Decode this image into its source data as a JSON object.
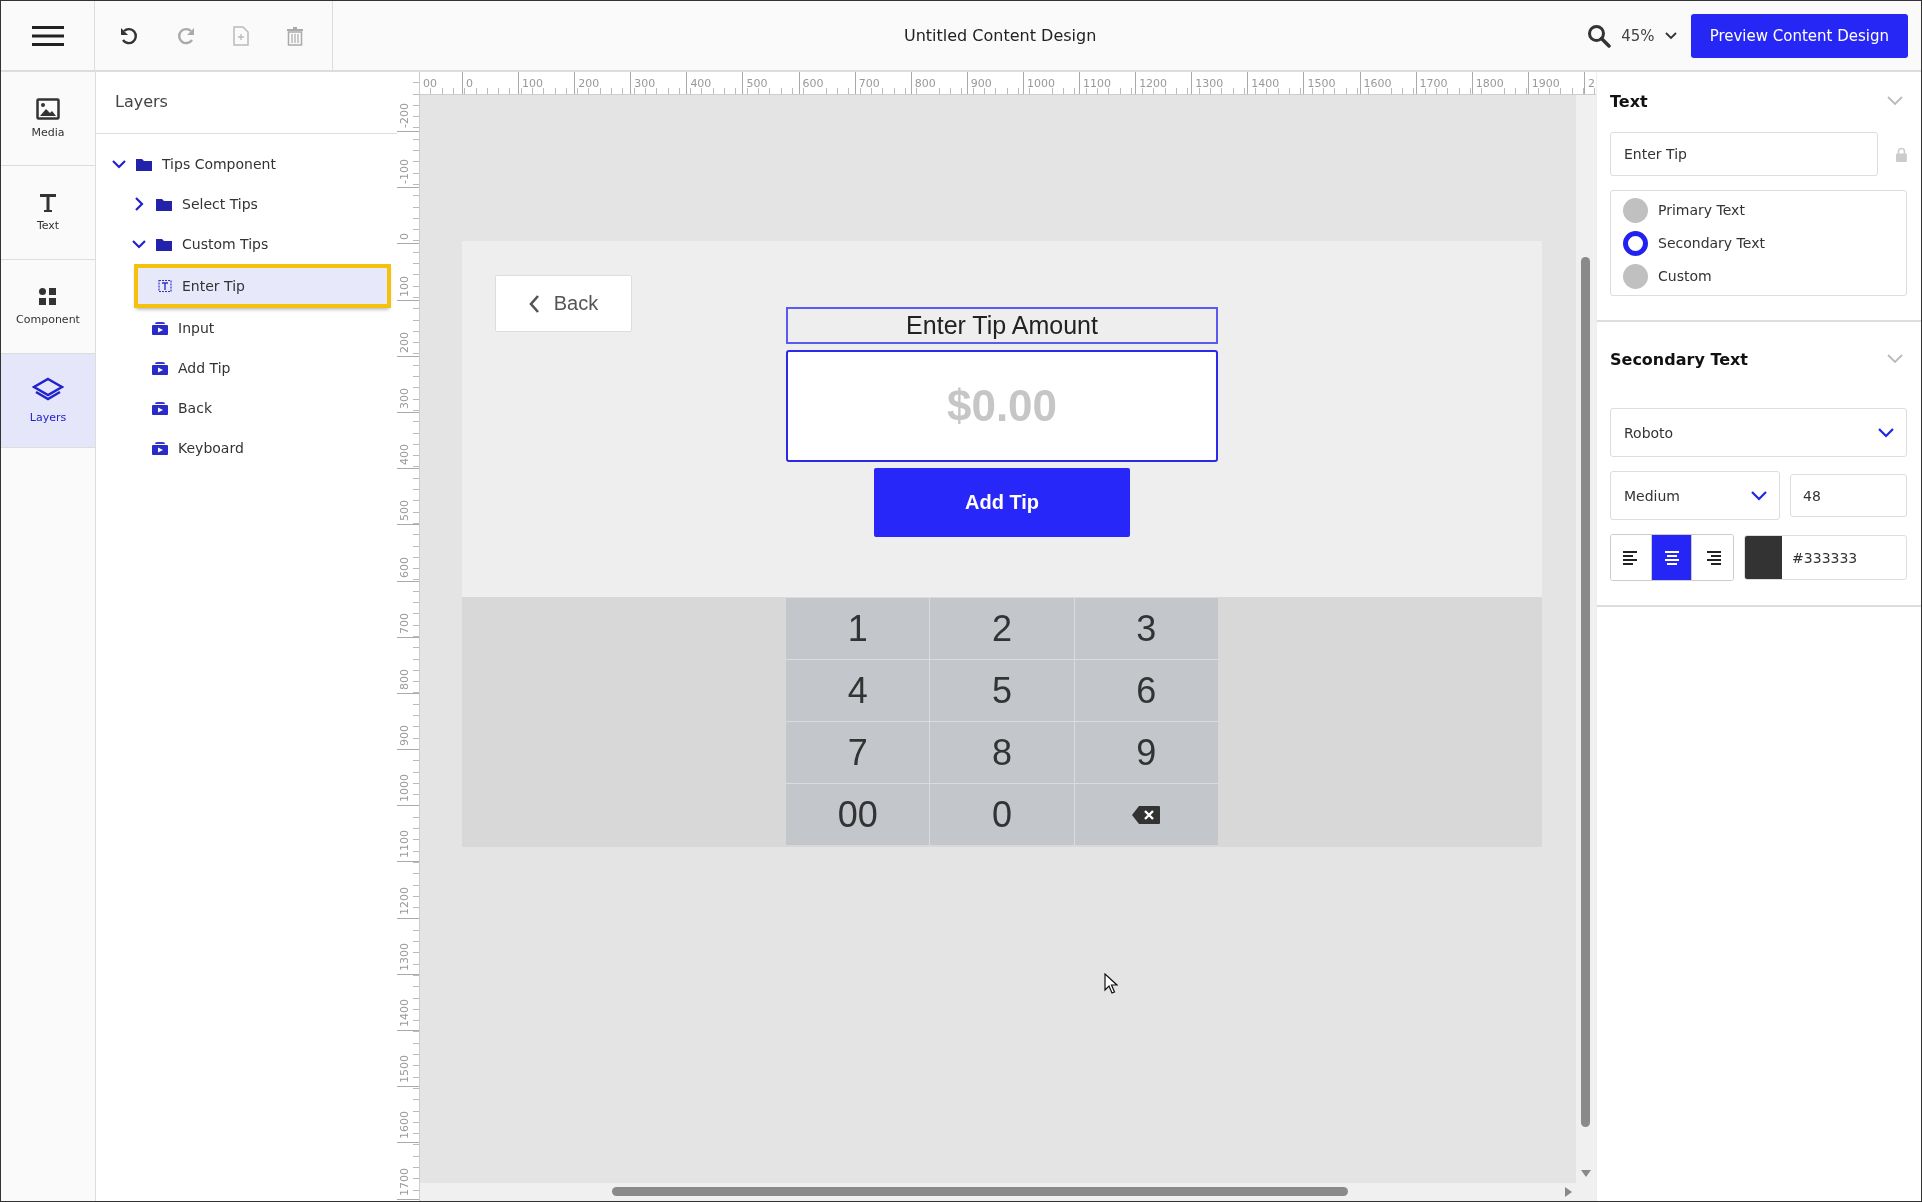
{
  "toolbar": {
    "title": "Untitled Content Design",
    "zoom": "45%",
    "preview_button": "Preview Content Design"
  },
  "rail": [
    {
      "label": "Media",
      "kind": "media",
      "selected": false
    },
    {
      "label": "Text",
      "kind": "text",
      "selected": false
    },
    {
      "label": "Component",
      "kind": "component",
      "selected": false
    },
    {
      "label": "Layers",
      "kind": "layers",
      "selected": true
    }
  ],
  "layers": {
    "title": "Layers",
    "tree": [
      {
        "label": "Tips Component",
        "kind": "folder",
        "expanded": true,
        "selected": false,
        "children": [
          {
            "label": "Select Tips",
            "kind": "folder",
            "expanded": false,
            "selected": false
          },
          {
            "label": "Custom Tips",
            "kind": "folder",
            "expanded": true,
            "selected": false,
            "children": [
              {
                "label": "Enter Tip",
                "kind": "text",
                "selected": true
              },
              {
                "label": "Input",
                "kind": "component",
                "selected": false
              },
              {
                "label": "Add Tip",
                "kind": "component",
                "selected": false
              },
              {
                "label": "Back",
                "kind": "component",
                "selected": false
              },
              {
                "label": "Keyboard",
                "kind": "component",
                "selected": false
              }
            ]
          }
        ]
      }
    ]
  },
  "rulers": {
    "horizontal": [
      "00",
      "0",
      "100",
      "200",
      "300",
      "400",
      "500",
      "600",
      "700",
      "800",
      "900",
      "1000",
      "1100",
      "1200",
      "1300",
      "1400",
      "1500",
      "1600",
      "1700",
      "1800",
      "1900",
      "2"
    ],
    "vertical": [
      "-200",
      "-100",
      "0",
      "100",
      "200",
      "300",
      "400",
      "500",
      "600",
      "700",
      "800",
      "900",
      "1000",
      "1100",
      "1200",
      "1300",
      "1400",
      "1500",
      "1600",
      "1700"
    ]
  },
  "canvas": {
    "back_button": "Back",
    "heading": "Enter Tip Amount",
    "amount": {
      "placeholder": "$0.00"
    },
    "add_button": "Add Tip",
    "keypad": [
      {
        "label": "1",
        "kind": "digit"
      },
      {
        "label": "2",
        "kind": "digit"
      },
      {
        "label": "3",
        "kind": "digit"
      },
      {
        "label": "4",
        "kind": "digit"
      },
      {
        "label": "5",
        "kind": "digit"
      },
      {
        "label": "6",
        "kind": "digit"
      },
      {
        "label": "7",
        "kind": "digit"
      },
      {
        "label": "8",
        "kind": "digit"
      },
      {
        "label": "9",
        "kind": "digit"
      },
      {
        "label": "00",
        "kind": "digit"
      },
      {
        "label": "0",
        "kind": "digit"
      },
      {
        "kind": "backspace"
      }
    ]
  },
  "properties": {
    "text_section": {
      "title": "Text",
      "value": "Enter Tip",
      "styles": [
        {
          "label": "Primary Text",
          "selected": false
        },
        {
          "label": "Secondary Text",
          "selected": true
        },
        {
          "label": "Custom",
          "selected": false
        }
      ]
    },
    "style_section": {
      "title": "Secondary Text",
      "font": "Roboto",
      "weight": "Medium",
      "size": "48",
      "align": [
        {
          "kind": "left",
          "selected": false
        },
        {
          "kind": "center",
          "selected": true
        },
        {
          "kind": "right",
          "selected": false
        }
      ],
      "color": "#333333"
    }
  }
}
